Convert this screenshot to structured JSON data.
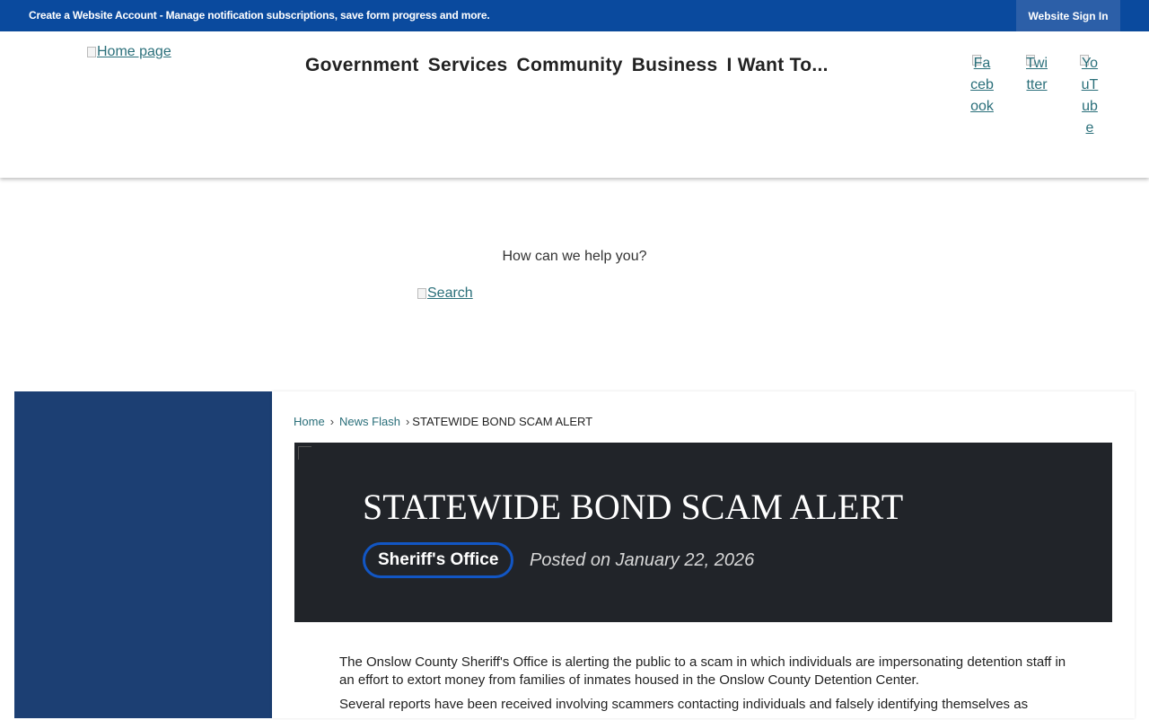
{
  "topbar": {
    "account_text": "Create a Website Account - Manage notification subscriptions, save form progress and more.",
    "signin_label": "Website Sign In"
  },
  "header": {
    "logo_alt": "Home page",
    "nav": [
      "Government",
      "Services",
      "Community",
      "Business",
      "I Want To..."
    ],
    "social": {
      "facebook": "Facebook",
      "twitter": "Twitter",
      "youtube": "YouTube"
    }
  },
  "search": {
    "prompt": "How can we help you?",
    "button_alt": "Search"
  },
  "breadcrumb": {
    "home": "Home",
    "news": "News Flash",
    "current": "STATEWIDE BOND SCAM ALERT"
  },
  "article": {
    "title": "STATEWIDE BOND SCAM ALERT",
    "category": "Sheriff's Office",
    "posted": "Posted on January 22, 2026",
    "paragraphs": [
      "The Onslow County Sheriff's Office is alerting the public to a scam in which individuals are impersonating detention staff in an effort to extort money from families of inmates housed in the Onslow County Detention Center.",
      "Several reports have been received involving scammers contacting individuals and falsely identifying themselves as"
    ]
  },
  "colors": {
    "topbar": "#0a4a9e",
    "sidebar": "#1c3f73",
    "hero": "#212429",
    "badge_border": "#1256c4"
  }
}
